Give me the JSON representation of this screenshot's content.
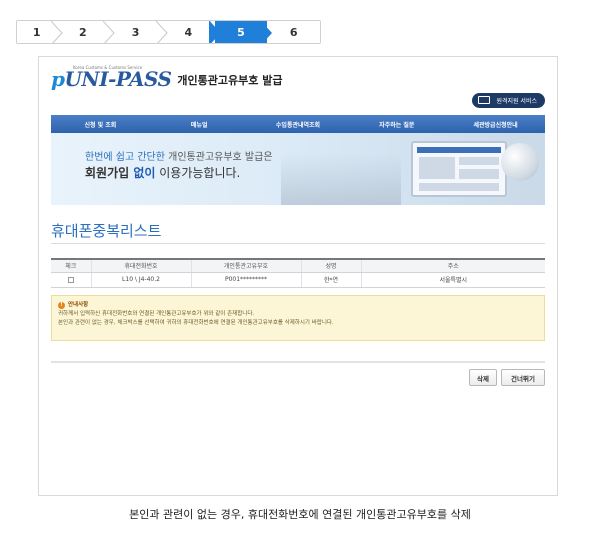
{
  "steps": [
    "1",
    "2",
    "3",
    "4",
    "5",
    "6"
  ],
  "active_step": "5",
  "colors": {
    "accent": "#1f7fd9",
    "nav": "#2d62ad",
    "title": "#2b6fbf",
    "notice_bg": "#fdf6d6"
  },
  "header": {
    "logo_tagline": "Korea Customs & Customs Service",
    "logo_text": "UNI-PASS",
    "logo_prefix": "p",
    "app_title": "개인통관고유부호 발급",
    "remote_button": "원격지원 서비스"
  },
  "nav": [
    "신청 및 조회",
    "매뉴얼",
    "수입통관내역조회",
    "자주하는 질문",
    "세관방급신청안내"
  ],
  "banner": {
    "line1_pre": "한번에 쉽고 간단한",
    "line1_post": " 개인통관고유부호 발급은",
    "line2_a": "회원가입",
    "line2_b": " 없이",
    "line2_c": " 이용가능합니다."
  },
  "section_title": "휴대폰중복리스트",
  "table": {
    "headers": [
      "체크",
      "휴대전화번호",
      "개인통관고유부호",
      "성명",
      "주소"
    ],
    "rows": [
      {
        "phone": "L10 \\ J4-40.2",
        "code": "P001*********",
        "name": "한*연",
        "address": "서울특별시"
      }
    ]
  },
  "notice": {
    "title": "안내사항",
    "line1": "귀하께서 입력하신 휴대전화번호와 연결된 개인통관고유부호가 위와 같이 존재합니다.",
    "line2": "본인과 관련이 없는 경우, 체크박스를 선택하여 귀하의 휴대전화번호에 연결된 개인통관고유부호를 삭제하시기 바랍니다."
  },
  "buttons": {
    "delete": "삭제",
    "skip": "건너뛰기"
  },
  "caption": "본인과 관련이 없는 경우, 휴대전화번호에 연결된 개인통관고유부호를 삭제"
}
